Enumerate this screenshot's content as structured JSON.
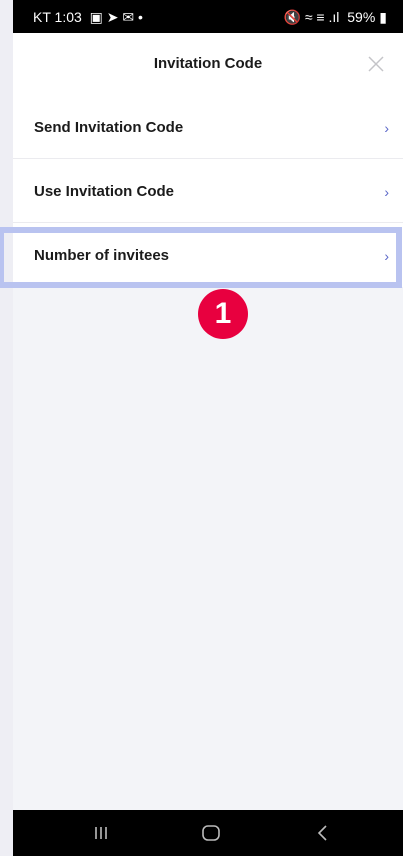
{
  "status_bar": {
    "carrier_time": "KT  1:03",
    "left_icons": "▣ ➤ ✉ •",
    "right_icons": "🔇 ≈ ≡ .ıl",
    "battery": "59%"
  },
  "header": {
    "title": "Invitation Code",
    "close_icon": "close-icon"
  },
  "menu": {
    "items": [
      {
        "label": "Send Invitation Code",
        "chevron": "›"
      },
      {
        "label": "Use Invitation Code",
        "chevron": "›"
      },
      {
        "label": "Number of invitees",
        "chevron": "›"
      }
    ]
  },
  "annotation": {
    "step_number": "1",
    "highlight_color": "#b9c3f0",
    "badge_color": "#e8003f"
  },
  "nav_bar": {
    "recent_icon": "recent-apps-icon",
    "home_icon": "home-icon",
    "back_icon": "back-icon"
  },
  "colors": {
    "accent_chevron": "#5a66c8",
    "background": "#f3f4f8",
    "status_bar": "#000000"
  }
}
